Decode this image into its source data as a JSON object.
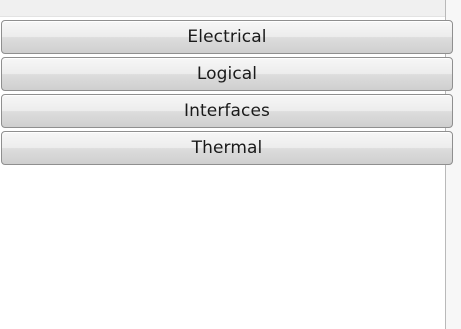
{
  "panel": {
    "buttons": [
      {
        "label": "Electrical"
      },
      {
        "label": "Logical"
      },
      {
        "label": "Interfaces"
      },
      {
        "label": "Thermal"
      }
    ]
  }
}
